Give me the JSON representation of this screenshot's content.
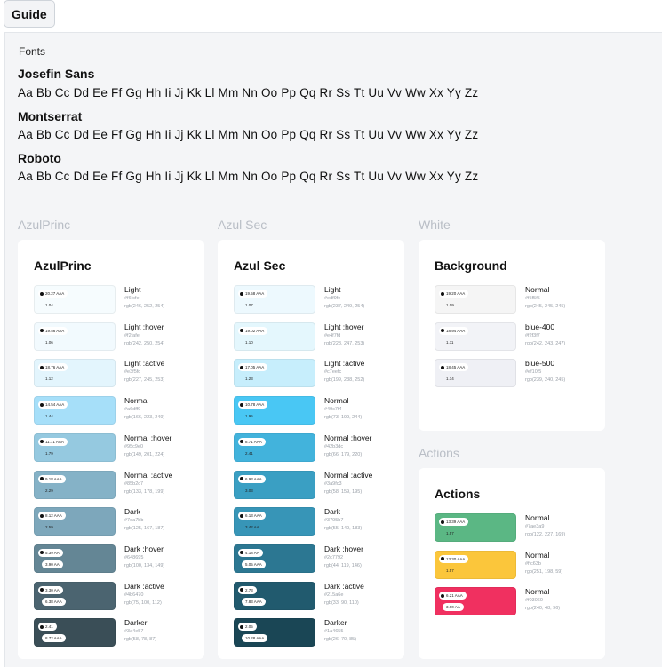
{
  "guide_label": "Guide",
  "fonts": {
    "label": "Fonts",
    "items": [
      {
        "name": "Josefin Sans",
        "sample": "Aa Bb Cc Dd Ee Ff Gg Hh Ii Jj Kk Ll Mm Nn Oo Pp Qq Rr Ss Tt Uu Vv Ww Xx Yy Zz"
      },
      {
        "name": "Montserrat",
        "sample": "Aa Bb Cc Dd Ee Ff Gg Hh Ii Jj Kk Ll Mm Nn Oo Pp Qq Rr Ss Tt Uu Vv Ww Xx Yy Zz"
      },
      {
        "name": "Roboto",
        "sample": "Aa Bb Cc Dd Ee Ff Gg Hh Ii Jj Kk Ll Mm Nn Oo Pp Qq Rr Ss Tt Uu Vv Ww Xx Yy Zz"
      }
    ]
  },
  "sections": {
    "azulprinc": "AzulPrinc",
    "azulsec": "Azul Sec",
    "white": "White",
    "actions": "Actions"
  },
  "cards": {
    "azulprinc": {
      "title": "AzulPrinc",
      "rows": [
        {
          "name": "Light",
          "hex": "#f6fcfe",
          "rgb": "rgb(246, 252, 254)",
          "color": "#f6fcfe",
          "contrast": "20.27 AAA",
          "ratio": "1.04",
          "dark_text": false
        },
        {
          "name": "Light :hover",
          "hex": "#f2fafe",
          "rgb": "rgb(242, 250, 254)",
          "color": "#f2fafe",
          "contrast": "19.56 AAA",
          "ratio": "1.06",
          "dark_text": false
        },
        {
          "name": "Light :active",
          "hex": "#e3f5fd",
          "rgb": "rgb(227, 245, 253)",
          "color": "#e3f5fd",
          "contrast": "18.76 AAA",
          "ratio": "1.12",
          "dark_text": false
        },
        {
          "name": "Normal",
          "hex": "#a6dff9",
          "rgb": "rgb(166, 223, 249)",
          "color": "#a6dff9",
          "contrast": "14.54 AAA",
          "ratio": "1.44",
          "dark_text": false
        },
        {
          "name": "Normal :hover",
          "hex": "#95c9e0",
          "rgb": "rgb(149, 201, 224)",
          "color": "#95c9e0",
          "contrast": "11.71 AAA",
          "ratio": "1.79",
          "dark_text": false
        },
        {
          "name": "Normal :active",
          "hex": "#85b2c7",
          "rgb": "rgb(133, 178, 199)",
          "color": "#85b2c7",
          "contrast": "9.18 AAA",
          "ratio": "2.29",
          "dark_text": false
        },
        {
          "name": "Dark",
          "hex": "#7da7bb",
          "rgb": "rgb(125, 167, 187)",
          "color": "#7da7bb",
          "contrast": "8.12 AAA",
          "ratio": "2.59",
          "dark_text": false
        },
        {
          "name": "Dark :hover",
          "hex": "#648695",
          "rgb": "rgb(100, 134, 149)",
          "color": "#648695",
          "contrast": "5.39 AA",
          "ratio": "3.90 AA",
          "dark_text": true
        },
        {
          "name": "Dark :active",
          "hex": "#4b6470",
          "rgb": "rgb(75, 100, 112)",
          "color": "#4b6470",
          "contrast": "3.30 AA",
          "ratio": "6.38 AAA",
          "dark_text": true
        },
        {
          "name": "Darker",
          "hex": "#3a4e57",
          "rgb": "rgb(58, 78, 87)",
          "color": "#3a4e57",
          "contrast": "2.41",
          "ratio": "8.72 AAA",
          "dark_text": true
        }
      ]
    },
    "azulsec": {
      "title": "Azul Sec",
      "rows": [
        {
          "name": "Light",
          "hex": "#edf9fe",
          "rgb": "rgb(237, 249, 254)",
          "color": "#edf9fe",
          "contrast": "19.58 AAA",
          "ratio": "1.07",
          "dark_text": false
        },
        {
          "name": "Light :hover",
          "hex": "#e4f7fd",
          "rgb": "rgb(228, 247, 253)",
          "color": "#e4f7fd",
          "contrast": "19.02 AAA",
          "ratio": "1.10",
          "dark_text": false
        },
        {
          "name": "Light :active",
          "hex": "#c7eefc",
          "rgb": "rgb(199, 238, 252)",
          "color": "#c7eefc",
          "contrast": "17.05 AAA",
          "ratio": "1.23",
          "dark_text": false
        },
        {
          "name": "Normal",
          "hex": "#49c7f4",
          "rgb": "rgb(73, 199, 244)",
          "color": "#49c7f4",
          "contrast": "10.78 AAA",
          "ratio": "1.95",
          "dark_text": false
        },
        {
          "name": "Normal :hover",
          "hex": "#42b3dc",
          "rgb": "rgb(66, 179, 220)",
          "color": "#42b3dc",
          "contrast": "8.71 AAA",
          "ratio": "2.41",
          "dark_text": false
        },
        {
          "name": "Normal :active",
          "hex": "#3a9fc3",
          "rgb": "rgb(58, 159, 195)",
          "color": "#3a9fc3",
          "contrast": "6.93 AAA",
          "ratio": "3.03",
          "dark_text": false
        },
        {
          "name": "Dark",
          "hex": "#3795b7",
          "rgb": "rgb(55, 149, 183)",
          "color": "#3795b7",
          "contrast": "6.13 AAA",
          "ratio": "3.42 AA",
          "dark_text": false
        },
        {
          "name": "Dark :hover",
          "hex": "#2c7792",
          "rgb": "rgb(44, 119, 146)",
          "color": "#2c7792",
          "contrast": "4.18 AA",
          "ratio": "5.05 AAA",
          "dark_text": true
        },
        {
          "name": "Dark :active",
          "hex": "#215a6e",
          "rgb": "rgb(33, 90, 110)",
          "color": "#215a6e",
          "contrast": "2.73",
          "ratio": "7.83 AAA",
          "dark_text": true
        },
        {
          "name": "Darker",
          "hex": "#1a4655",
          "rgb": "rgb(26, 70, 85)",
          "color": "#1a4655",
          "contrast": "2.05",
          "ratio": "10.28 AAA",
          "dark_text": true
        }
      ]
    },
    "white": {
      "title": "Background",
      "rows": [
        {
          "name": "Normal",
          "hex": "#f5f5f5",
          "rgb": "rgb(245, 245, 245)",
          "color": "#f5f5f5",
          "contrast": "19.20 AAA",
          "ratio": "1.09",
          "dark_text": false
        },
        {
          "name": "blue-400",
          "hex": "#f2f3f7",
          "rgb": "rgb(242, 243, 247)",
          "color": "#f2f3f7",
          "contrast": "18.94 AAA",
          "ratio": "1.11",
          "dark_text": false
        },
        {
          "name": "blue-500",
          "hex": "#ef10f5",
          "rgb": "rgb(239, 240, 245)",
          "color": "#eff0f5",
          "contrast": "18.45 AAA",
          "ratio": "1.14",
          "dark_text": false
        }
      ]
    },
    "actions": {
      "title": "Actions",
      "rows": [
        {
          "name": "Normal",
          "hex": "#7ae3a9",
          "rgb": "rgb(122, 227, 169)",
          "color": "#5bb784",
          "contrast": "13.39 AAA",
          "ratio": "1.57",
          "dark_text": false
        },
        {
          "name": "Normal",
          "hex": "#ffc63b",
          "rgb": "rgb(251, 198, 59)",
          "color": "#fbc63b",
          "contrast": "13.30 AAA",
          "ratio": "1.57",
          "dark_text": false
        },
        {
          "name": "Normal",
          "hex": "#f03060",
          "rgb": "rgb(240, 48, 96)",
          "color": "#f03060",
          "contrast": "6.21 AAA",
          "ratio": "3.90 AA",
          "dark_text": true
        }
      ]
    }
  }
}
